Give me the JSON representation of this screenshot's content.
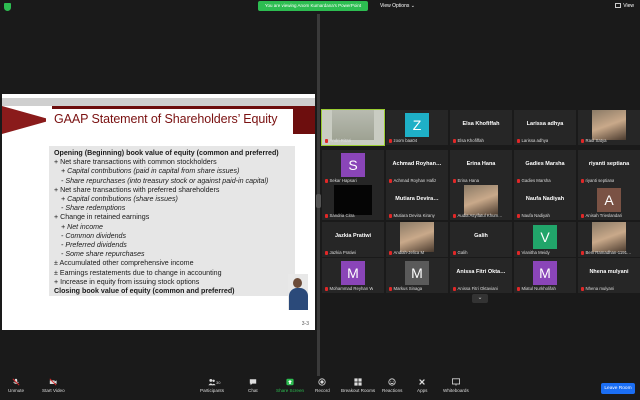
{
  "top_bar": {
    "viewing_banner": "You are viewing Anom Kumardana's PowerPoint",
    "view_options": "View Options ⌄",
    "view": "View"
  },
  "slide": {
    "title": "GAAP Statement of Shareholders’ Equity",
    "page_number": "3-3",
    "lines": [
      {
        "text": "Opening (Beginning) book value of equity (common and preferred)",
        "style": "b",
        "indent": 0
      },
      {
        "text": "+ Net share transactions with common stockholders",
        "style": "",
        "indent": 0
      },
      {
        "text": "+ Capital contributions (paid in capital from share issues)",
        "style": "i",
        "indent": 1
      },
      {
        "text": "- Share repurchases (into treasury stock or against paid-in capital)",
        "style": "i",
        "indent": 1
      },
      {
        "text": "+ Net share transactions with preferred shareholders",
        "style": "",
        "indent": 0
      },
      {
        "text": "+ Capital contributions (share issues)",
        "style": "i",
        "indent": 1
      },
      {
        "text": "- Share redemptions",
        "style": "i",
        "indent": 1
      },
      {
        "text": "+ Change in retained earnings",
        "style": "",
        "indent": 0
      },
      {
        "text": "+ Net income",
        "style": "i",
        "indent": 1
      },
      {
        "text": "- Common dividends",
        "style": "i",
        "indent": 1
      },
      {
        "text": "- Preferred dividends",
        "style": "i",
        "indent": 1
      },
      {
        "text": "- Some share repurchases",
        "style": "i",
        "indent": 1
      },
      {
        "text": "± Accumulated other comprehensive income",
        "style": "",
        "indent": 0
      },
      {
        "text": "± Earnings restatements due to change in accounting",
        "style": "",
        "indent": 0
      },
      {
        "text": "+ Increase in equity from issuing stock options",
        "style": "",
        "indent": 0
      },
      {
        "text": "Closing book value of equity (common and preferred)",
        "style": "b",
        "indent": 0
      }
    ]
  },
  "participants": [
    {
      "name": "Andri Ritzal",
      "big": "",
      "avatar": "",
      "avatar_color": "",
      "kind": "active"
    },
    {
      "name": "zoom baa04",
      "big": "",
      "avatar": "Z",
      "avatar_color": "#1eb0c7",
      "kind": "avatar"
    },
    {
      "name": "Elsa Khofiffah",
      "big": "Elsa Khofiffah",
      "avatar": "",
      "avatar_color": "",
      "kind": "text"
    },
    {
      "name": "Larissa adhya",
      "big": "Larissa adhya",
      "avatar": "",
      "avatar_color": "",
      "kind": "text"
    },
    {
      "name": "Raul Satya",
      "big": "",
      "avatar": "",
      "avatar_color": "",
      "kind": "photo"
    },
    {
      "name": "Sekar Hapsari",
      "big": "",
      "avatar": "S",
      "avatar_color": "#8a45b8",
      "kind": "avatar"
    },
    {
      "name": "Achmad Royhan Hafiz",
      "big": "Achmad Royhan…",
      "avatar": "",
      "avatar_color": "",
      "kind": "text"
    },
    {
      "name": "Erina Hana",
      "big": "Erina Hana",
      "avatar": "",
      "avatar_color": "",
      "kind": "text"
    },
    {
      "name": "Gadies Marsha",
      "big": "Gadies Marsha",
      "avatar": "",
      "avatar_color": "",
      "kind": "text"
    },
    {
      "name": "riyanti septiana",
      "big": "riyanti septiana",
      "avatar": "",
      "avatar_color": "",
      "kind": "text"
    },
    {
      "name": "Sandria Citra",
      "big": "",
      "avatar": "",
      "avatar_color": "",
      "kind": "dark"
    },
    {
      "name": "Mutiara Devira Kirany",
      "big": "Mutiara Devira…",
      "avatar": "",
      "avatar_color": "",
      "kind": "text"
    },
    {
      "name": "Audia Asyifatul Khum…",
      "big": "",
      "avatar": "",
      "avatar_color": "",
      "kind": "photo"
    },
    {
      "name": "Naufa Nadiyah",
      "big": "Naufa Nadiyah",
      "avatar": "",
      "avatar_color": "",
      "kind": "text"
    },
    {
      "name": "Anisah Trieslandari",
      "big": "",
      "avatar": "A",
      "avatar_color": "#7a5244",
      "kind": "avatar"
    },
    {
      "name": "Jazkia Pratiwi",
      "big": "Jazkia Pratiwi",
      "avatar": "",
      "avatar_color": "",
      "kind": "text"
    },
    {
      "name": "Andiah-Jelica M",
      "big": "",
      "avatar": "",
      "avatar_color": "",
      "kind": "photo"
    },
    {
      "name": "Galih",
      "big": "Galih",
      "avatar": "",
      "avatar_color": "",
      "kind": "text"
    },
    {
      "name": "Vianitha Meidy",
      "big": "",
      "avatar": "V",
      "avatar_color": "#21a56a",
      "kind": "avatar"
    },
    {
      "name": "Beni Ramadhan-1191…",
      "big": "",
      "avatar": "",
      "avatar_color": "",
      "kind": "photo"
    },
    {
      "name": "Mohammad Reyhan W",
      "big": "",
      "avatar": "M",
      "avatar_color": "#8a45b8",
      "kind": "avatar"
    },
    {
      "name": "Markus Sinaga",
      "big": "",
      "avatar": "M",
      "avatar_color": "#5a5a5a",
      "kind": "avatar"
    },
    {
      "name": "Anissa Fitri Oktaviani",
      "big": "Anissa Fitri Okta…",
      "avatar": "",
      "avatar_color": "",
      "kind": "text"
    },
    {
      "name": "Miatul Nurkholifah",
      "big": "",
      "avatar": "M",
      "avatar_color": "#8a45b8",
      "kind": "avatar"
    },
    {
      "name": "Nhena mulyani",
      "big": "Nhena mulyani",
      "avatar": "",
      "avatar_color": "",
      "kind": "text"
    }
  ],
  "toolbar": {
    "unmute": "Unmute",
    "start_video": "Start Video",
    "participants": "Participants",
    "participants_count": "30",
    "chat": "Chat",
    "share_screen": "Share Screen",
    "record": "Record",
    "breakout_rooms": "Breakout Rooms",
    "reactions": "Reactions",
    "apps": "Apps",
    "whiteboards": "Whiteboards",
    "leave_room": "Leave Room"
  },
  "colors": {
    "share_green": "#2dbd51",
    "leave_blue": "#1b6ef3",
    "slide_red": "#7a1111",
    "mic_red": "#e02828"
  }
}
